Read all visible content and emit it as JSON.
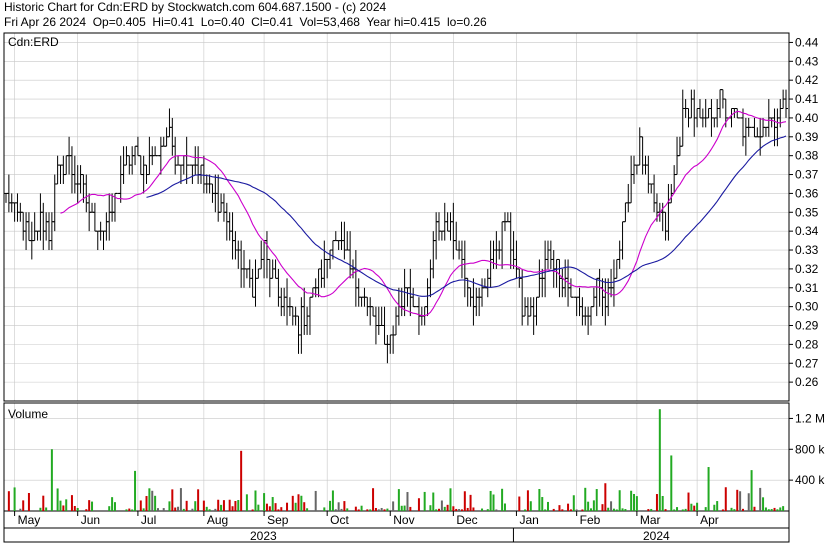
{
  "header": {
    "line1": "Historic Chart for Cdn:ERD by Stockwatch.com 604.687.1500 - (c) 2024",
    "line2": "Fri Apr 26 2024  Op=0.405  Hi=0.41  Lo=0.40  Cl=0.41  Vol=53,468  Year hi=0.415  lo=0.26"
  },
  "price_panel": {
    "symbol": "Cdn:ERD"
  },
  "volume_panel": {
    "label": "Volume"
  },
  "colors": {
    "bars": "#000000",
    "ma_short": "#cc00cc",
    "ma_long": "#1a1aa0",
    "vol_up": "#22aa22",
    "vol_down": "#cc0000",
    "vol_flat": "#666666",
    "grid": "#c8c8c8"
  },
  "chart_data": [
    {
      "type": "ohlc",
      "title": "Historic Chart for Cdn:ERD",
      "ylim": [
        0.25,
        0.445
      ],
      "y_ticks": [
        "0.44",
        "0.43",
        "0.42",
        "0.41",
        "0.40",
        "0.39",
        "0.38",
        "0.37",
        "0.36",
        "0.35",
        "0.34",
        "0.33",
        "0.32",
        "0.31",
        "0.30",
        "0.29",
        "0.28",
        "0.27",
        "0.26"
      ],
      "x_ticks": [
        "May",
        "Jun",
        "Jul",
        "Aug",
        "Sep",
        "Oct",
        "Nov",
        "Dec",
        "Jan",
        "Feb",
        "Mar",
        "Apr"
      ],
      "year_labels": [
        "2023",
        "2024"
      ],
      "close_anchors": [
        [
          0,
          0.36
        ],
        [
          3,
          0.35
        ],
        [
          6,
          0.345
        ],
        [
          9,
          0.33
        ],
        [
          12,
          0.345
        ],
        [
          15,
          0.34
        ],
        [
          18,
          0.37
        ],
        [
          21,
          0.38
        ],
        [
          24,
          0.37
        ],
        [
          27,
          0.36
        ],
        [
          30,
          0.345
        ],
        [
          33,
          0.34
        ],
        [
          36,
          0.345
        ],
        [
          40,
          0.37
        ],
        [
          44,
          0.38
        ],
        [
          48,
          0.375
        ],
        [
          52,
          0.38
        ],
        [
          56,
          0.39
        ],
        [
          60,
          0.38
        ],
        [
          64,
          0.38
        ],
        [
          68,
          0.37
        ],
        [
          72,
          0.36
        ],
        [
          76,
          0.35
        ],
        [
          80,
          0.33
        ],
        [
          83,
          0.32
        ],
        [
          86,
          0.31
        ],
        [
          90,
          0.33
        ],
        [
          94,
          0.31
        ],
        [
          98,
          0.3
        ],
        [
          102,
          0.29
        ],
        [
          105,
          0.3
        ],
        [
          108,
          0.31
        ],
        [
          111,
          0.32
        ],
        [
          114,
          0.34
        ],
        [
          117,
          0.33
        ],
        [
          120,
          0.32
        ],
        [
          123,
          0.31
        ],
        [
          126,
          0.3
        ],
        [
          129,
          0.29
        ],
        [
          132,
          0.28
        ],
        [
          134,
          0.285
        ],
        [
          137,
          0.3
        ],
        [
          140,
          0.31
        ],
        [
          143,
          0.3
        ],
        [
          146,
          0.295
        ],
        [
          150,
          0.34
        ],
        [
          154,
          0.345
        ],
        [
          158,
          0.33
        ],
        [
          162,
          0.31
        ],
        [
          165,
          0.3
        ],
        [
          168,
          0.32
        ],
        [
          171,
          0.33
        ],
        [
          174,
          0.345
        ],
        [
          177,
          0.33
        ],
        [
          180,
          0.3
        ],
        [
          183,
          0.295
        ],
        [
          186,
          0.31
        ],
        [
          189,
          0.33
        ],
        [
          193,
          0.32
        ],
        [
          196,
          0.31
        ],
        [
          200,
          0.3
        ],
        [
          203,
          0.295
        ],
        [
          206,
          0.31
        ],
        [
          209,
          0.3
        ],
        [
          212,
          0.32
        ],
        [
          215,
          0.34
        ],
        [
          218,
          0.37
        ],
        [
          221,
          0.385
        ],
        [
          224,
          0.36
        ],
        [
          227,
          0.35
        ],
        [
          230,
          0.34
        ],
        [
          233,
          0.37
        ],
        [
          236,
          0.4
        ],
        [
          239,
          0.41
        ],
        [
          242,
          0.395
        ],
        [
          245,
          0.4
        ],
        [
          248,
          0.41
        ],
        [
          251,
          0.405
        ],
        [
          254,
          0.4
        ],
        [
          257,
          0.395
        ],
        [
          260,
          0.39
        ],
        [
          263,
          0.395
        ],
        [
          266,
          0.4
        ],
        [
          269,
          0.4
        ],
        [
          272,
          0.41
        ]
      ],
      "n_bars": 273,
      "series": [
        {
          "name": "Price",
          "kind": "ohlc"
        },
        {
          "name": "Short moving average",
          "kind": "line"
        },
        {
          "name": "Long moving average",
          "kind": "line"
        }
      ],
      "grid": true
    },
    {
      "type": "bar",
      "title": "Volume",
      "ylim": [
        0,
        1400000
      ],
      "y_ticks": [
        {
          "v": 1200000,
          "label": "1.2 M"
        },
        {
          "v": 800000,
          "label": "800 k"
        },
        {
          "v": 400000,
          "label": "400 k"
        }
      ],
      "spikes": [
        [
          16,
          800000
        ],
        [
          45,
          520000
        ],
        [
          82,
          780000
        ],
        [
          209,
          360000
        ],
        [
          228,
          1320000
        ],
        [
          232,
          720000
        ],
        [
          245,
          570000
        ],
        [
          260,
          530000
        ]
      ],
      "grid": true
    }
  ]
}
